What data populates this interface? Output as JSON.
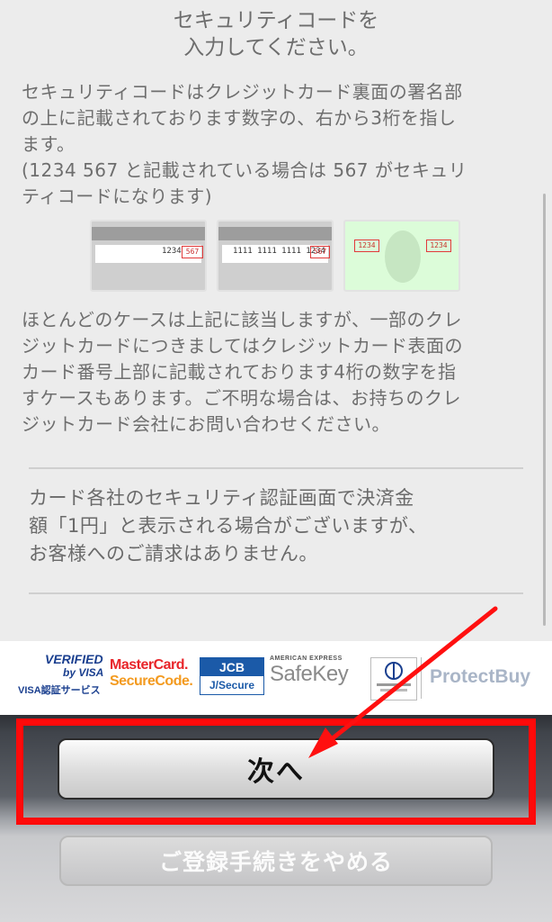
{
  "heading": {
    "line1": "セキュリティコードを",
    "line2": "入力してください。"
  },
  "description": {
    "lines": [
      "セキュリティコードはクレジットカード裏面の署名部",
      "の上に記載されております数字の、右から3桁を指し",
      "ます。",
      "(1234 567 と記載されている場合は 567 がセキュリ",
      "ティコードになります)"
    ]
  },
  "cards": [
    {
      "number": "1234",
      "code": "567"
    },
    {
      "number": "1111 1111 1111 1234",
      "code": "567"
    },
    {
      "left": "1234",
      "right": "1234"
    }
  ],
  "note": {
    "lines": [
      "ほとんどのケースは上記に該当しますが、一部のクレ",
      "ジットカードにつきましてはクレジットカード表面の",
      "カード番号上部に記載されております4桁の数字を指",
      "すケースもあります。ご不明な場合は、お持ちのクレ",
      "ジットカード会社にお問い合わせください。"
    ]
  },
  "notice": {
    "lines": [
      "カード各社のセキュリティ認証画面で決済金",
      "額「1円」と表示される場合がございますが、",
      "お客様へのご請求はありません。"
    ]
  },
  "logos": {
    "verified_line1": "VERIFIED",
    "verified_line2": "by VISA",
    "verified_line3": "VISA認証サービス",
    "mastercard_line1": "MasterCard.",
    "mastercard_line2": "SecureCode.",
    "jcb_line1": "JCB",
    "jcb_line2": "J/Secure",
    "amex_line1": "AMERICAN EXPRESS",
    "amex_line2": "SafeKey",
    "protectbuy": "ProtectBuy"
  },
  "buttons": {
    "next": "次へ",
    "cancel": "ご登録手続きをやめる"
  },
  "colors": {
    "highlight": "#ff0a0a",
    "arrow": "#ff1010",
    "mastercard_red": "#e8252a",
    "mastercard_orange": "#f39a1f",
    "jcb_blue": "#1b5aa8"
  }
}
